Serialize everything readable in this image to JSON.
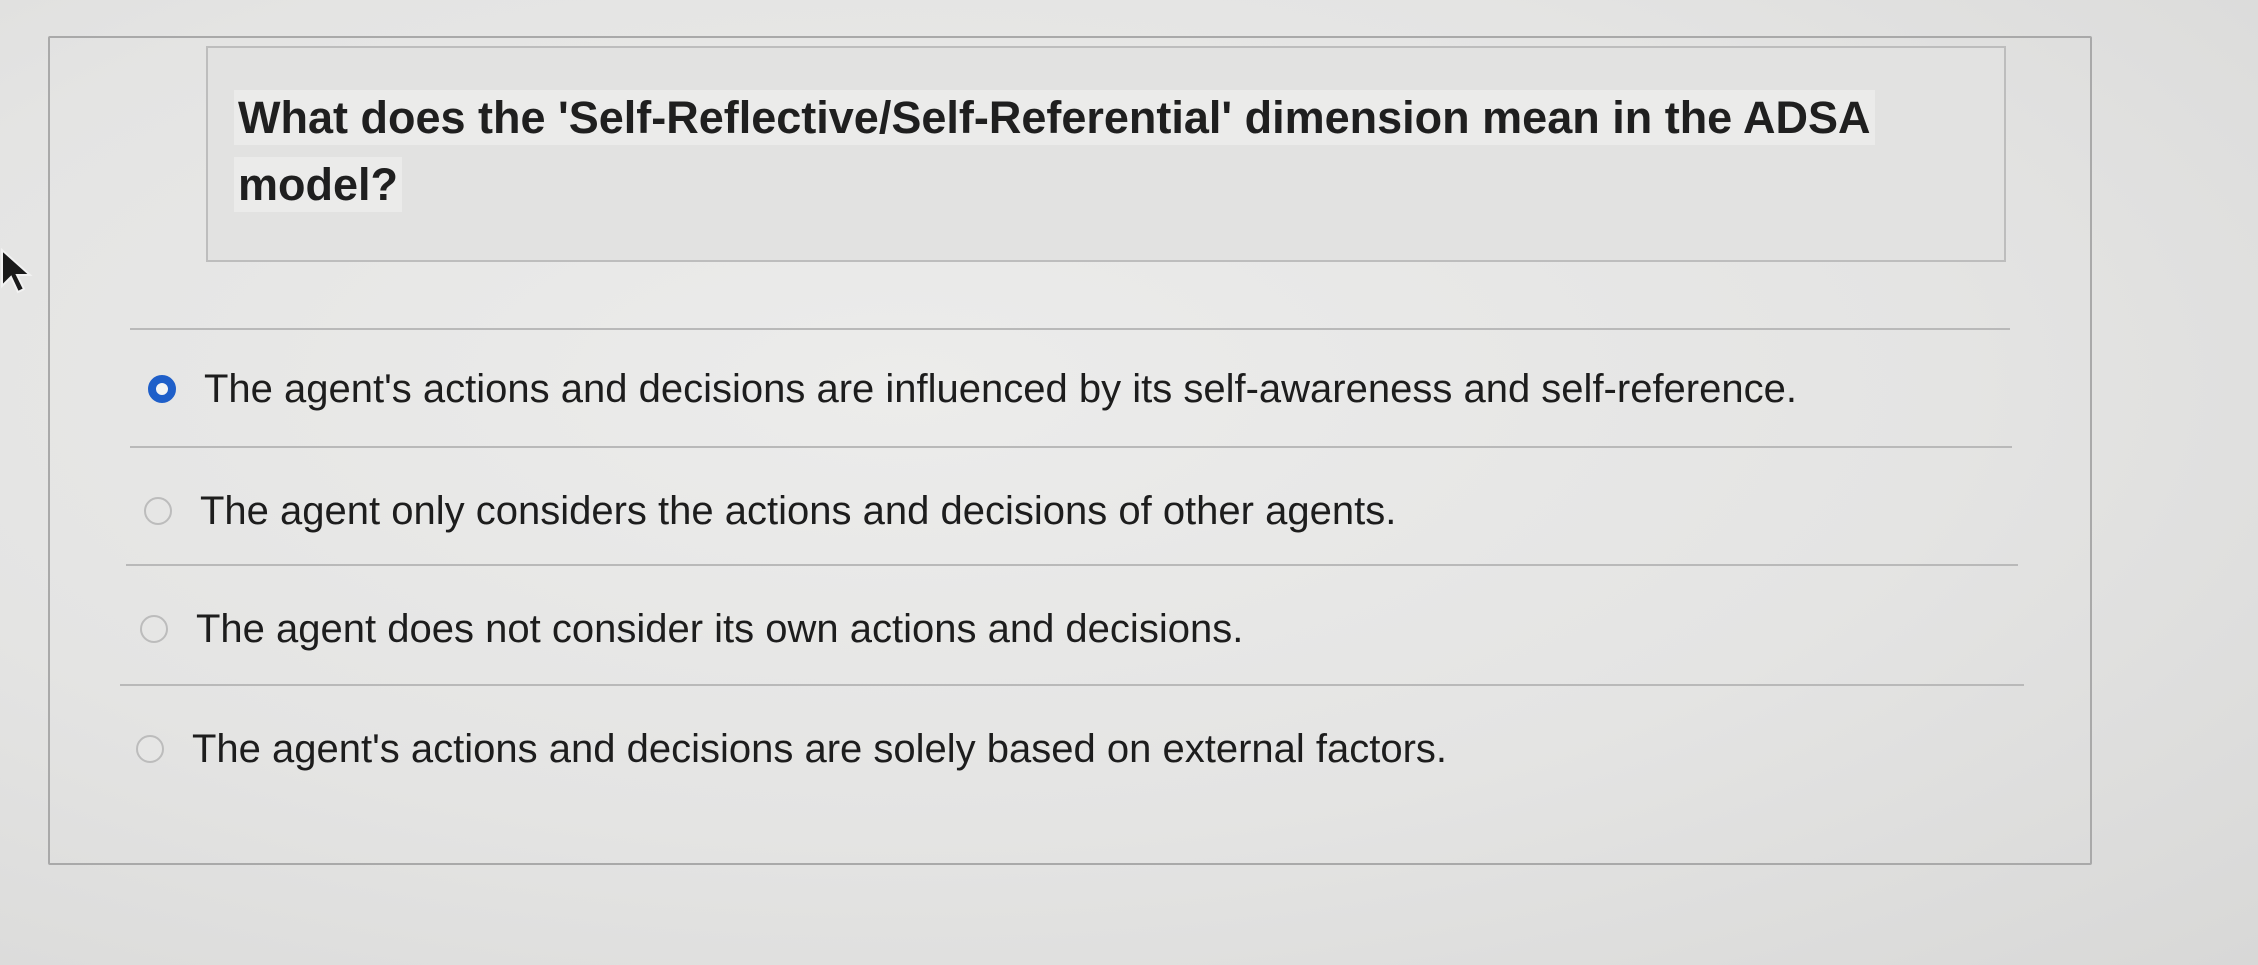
{
  "question": {
    "text": "What does the 'Self-Reflective/Self-Referential' dimension mean in the ADSA model?"
  },
  "options": [
    {
      "label": "The agent's actions and decisions are influenced by its self-awareness and self-reference.",
      "selected": true
    },
    {
      "label": "The agent only considers the actions and decisions of other agents.",
      "selected": false
    },
    {
      "label": "The agent does not consider its own actions and decisions.",
      "selected": false
    },
    {
      "label": "The agent's actions and decisions are solely based on external factors.",
      "selected": false
    }
  ],
  "colors": {
    "selected_radio": "#1f5fc9",
    "text": "#1d1d1d",
    "background": "#e4e4e3"
  },
  "icons": {
    "cursor": "mouse-pointer-icon"
  }
}
